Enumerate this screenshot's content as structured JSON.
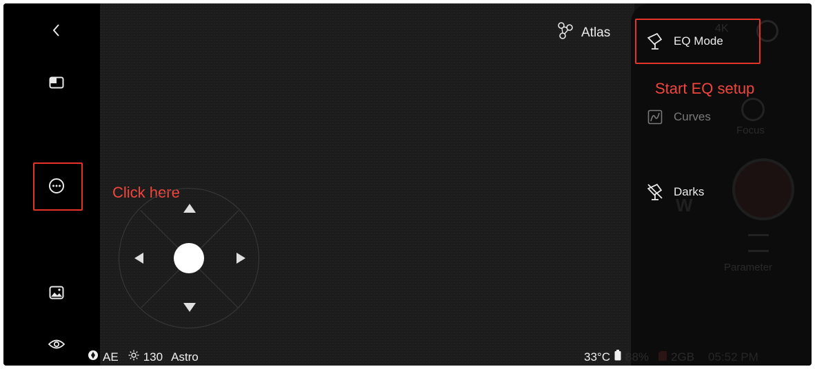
{
  "header": {
    "atlas_label": "Atlas"
  },
  "menu": {
    "eq_mode": "EQ Mode",
    "curves": "Curves",
    "darks": "Darks"
  },
  "annotations": {
    "click_here": "Click here",
    "start_eq": "Start EQ setup"
  },
  "ghost_controls": {
    "focus": "Focus",
    "parameter": "Parameter",
    "wide": "W",
    "resolution": "4K"
  },
  "status_bar": {
    "ae": "AE",
    "brightness": "130",
    "mode": "Astro",
    "temperature": "33°C",
    "battery": "88%",
    "storage": "2GB",
    "time": "05:52 PM"
  },
  "colors": {
    "highlight": "#e5332a",
    "background": "#141414"
  },
  "icons": [
    "back-icon",
    "layout-icon",
    "more-icon",
    "gallery-icon",
    "eye-icon",
    "atlas-icon",
    "eq-mode-icon",
    "curves-icon",
    "darks-icon",
    "aperture-icon",
    "sun-icon",
    "battery-icon",
    "sdcard-icon"
  ]
}
